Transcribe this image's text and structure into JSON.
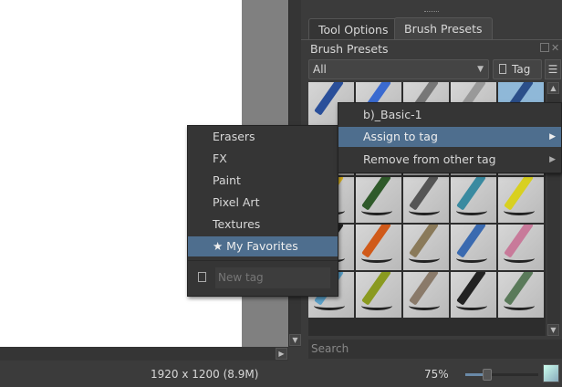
{
  "tabs": [
    {
      "label": "Tool Options",
      "active": false
    },
    {
      "label": "Brush Presets",
      "active": true
    }
  ],
  "docker_title": "Brush Presets",
  "filter_select": "All",
  "tag_button": "Tag",
  "search_placeholder": "Search",
  "context_menu": {
    "title": "b)_Basic-1",
    "items": [
      {
        "label": "Assign to tag",
        "highlighted": true
      },
      {
        "label": "Remove from other tag",
        "highlighted": false
      }
    ]
  },
  "tag_submenu": {
    "items": [
      {
        "label": "Erasers"
      },
      {
        "label": "FX"
      },
      {
        "label": "Paint"
      },
      {
        "label": "Pixel Art"
      },
      {
        "label": "Textures"
      },
      {
        "label": "★ My Favorites",
        "highlighted": true
      }
    ],
    "new_tag_placeholder": "New tag"
  },
  "status": {
    "image_size": "1920 x 1200 (8.9M)",
    "zoom": "75%",
    "zoom_slider_fraction": 0.3
  },
  "colors": {
    "highlight": "#4e6e8e",
    "panel": "#3b3b3b"
  }
}
